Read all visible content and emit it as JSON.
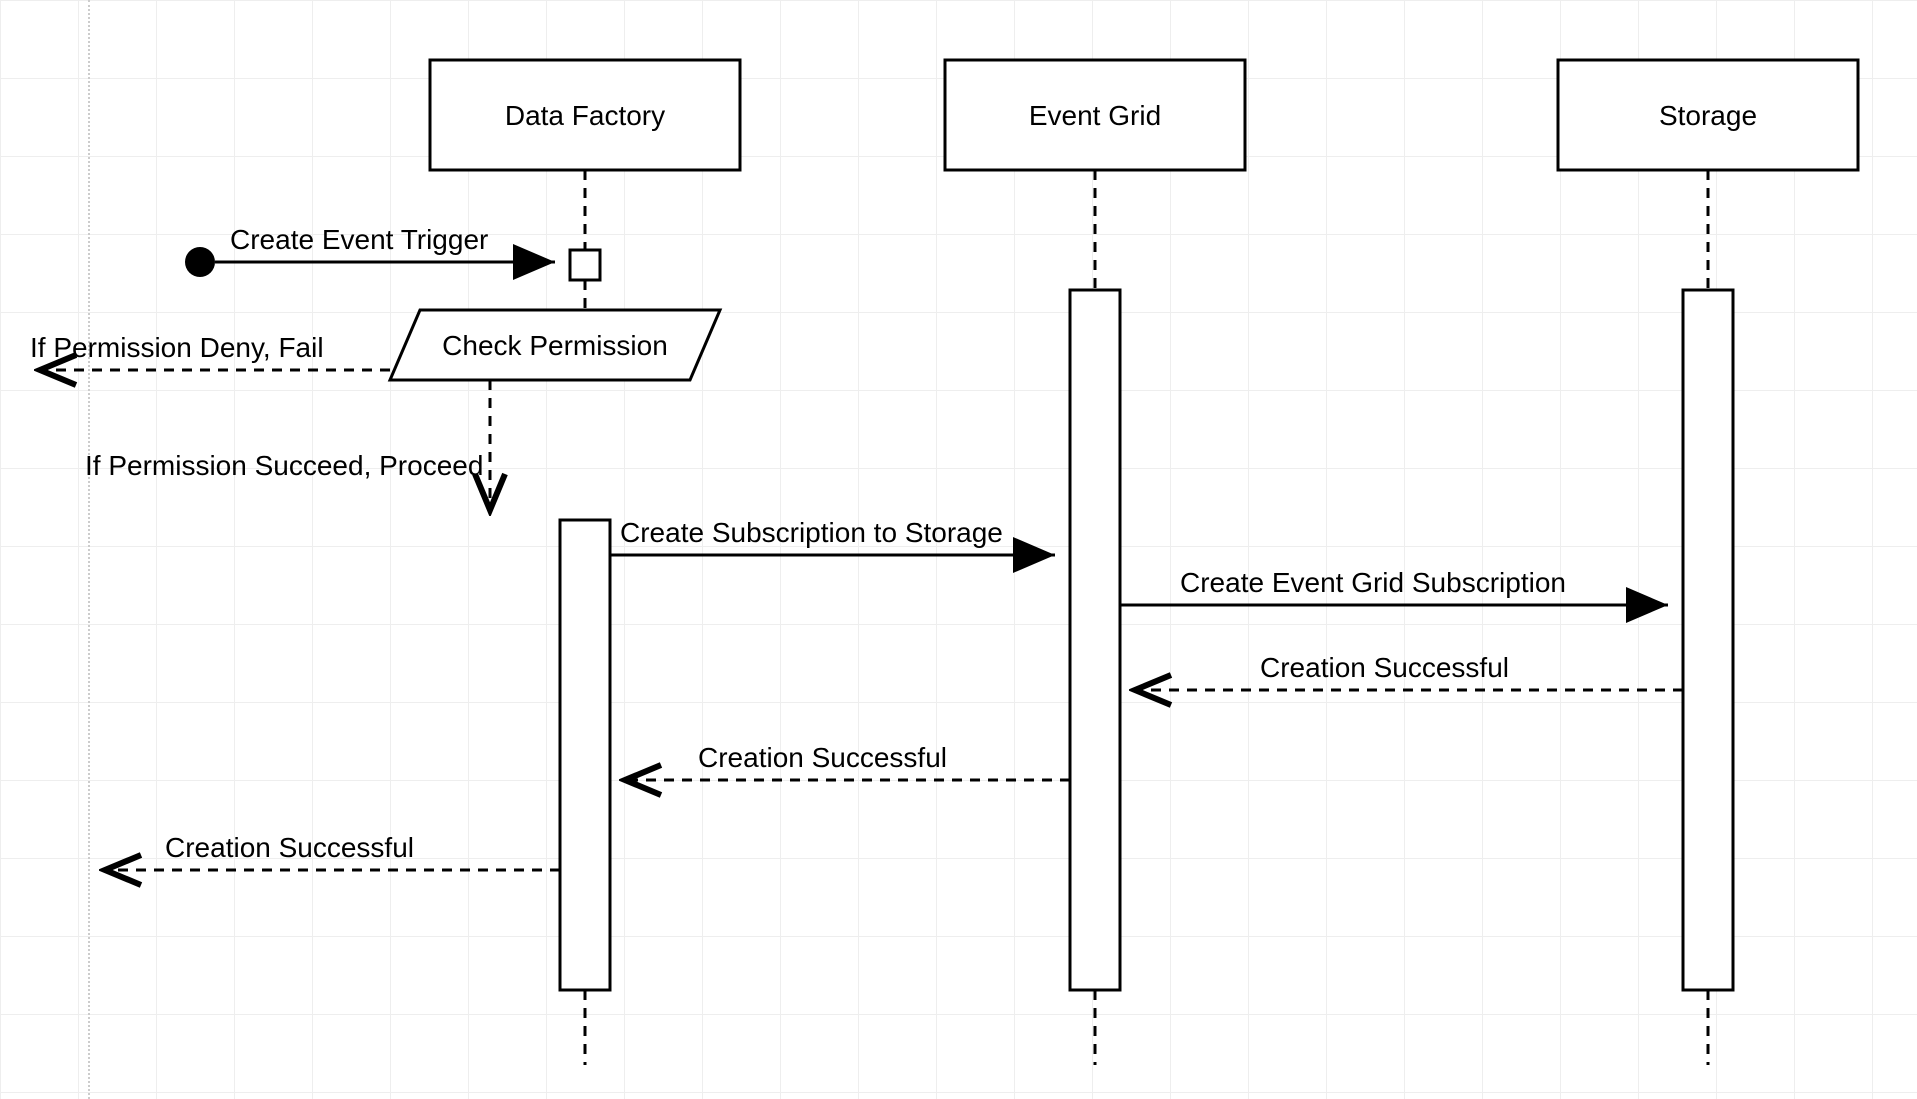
{
  "participants": {
    "data_factory": "Data Factory",
    "event_grid": "Event Grid",
    "storage": "Storage"
  },
  "messages": {
    "create_event_trigger": "Create Event Trigger",
    "check_permission": "Check Permission",
    "permission_deny": "If Permission Deny, Fail",
    "permission_succeed": "If Permission Succeed, Proceed",
    "create_subscription": "Create Subscription to Storage",
    "create_event_grid_sub": "Create Event Grid Subscription",
    "creation_successful_1": "Creation Successful",
    "creation_successful_2": "Creation Successful",
    "creation_successful_3": "Creation Successful"
  }
}
